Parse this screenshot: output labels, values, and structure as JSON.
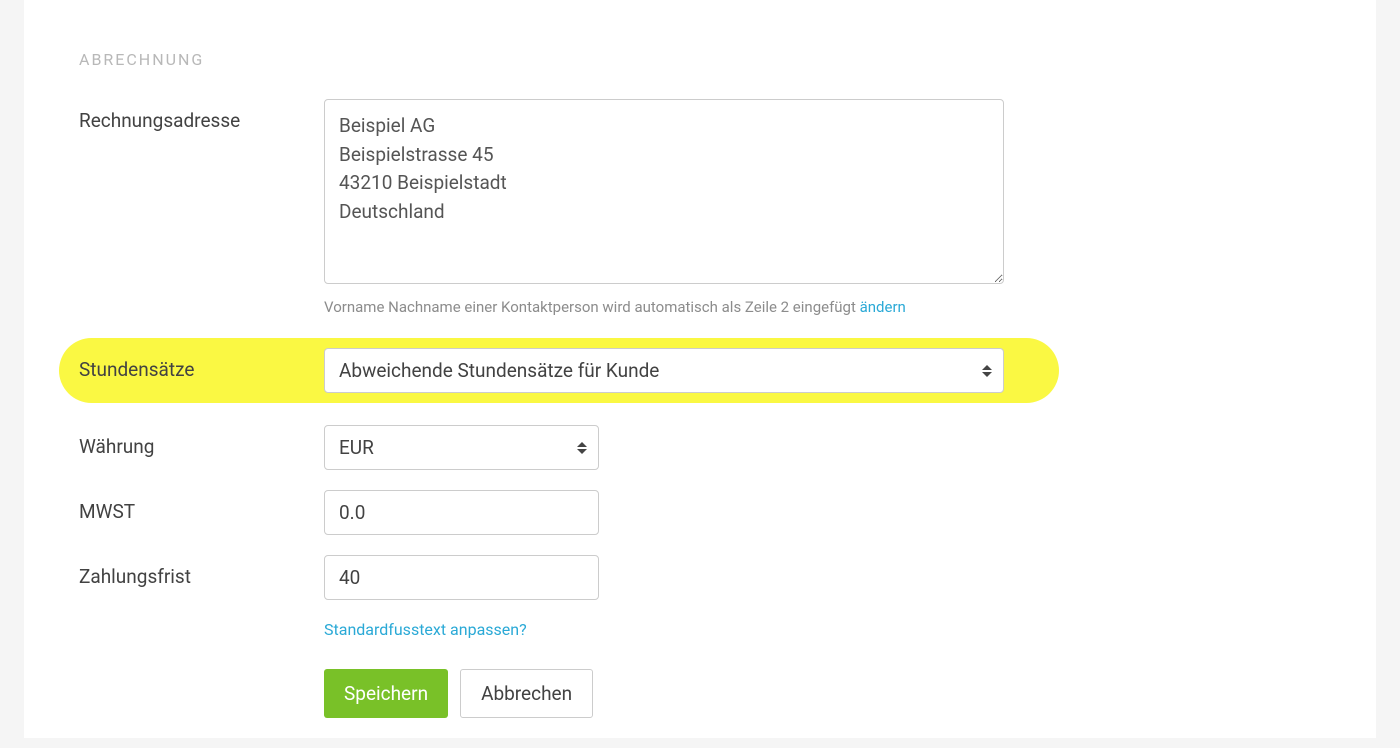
{
  "section": {
    "title": "ABRECHNUNG"
  },
  "fields": {
    "billing_address": {
      "label": "Rechnungsadresse",
      "value": "Beispiel AG\nBeispielstrasse 45\n43210 Beispielstadt\nDeutschland",
      "hint_text": "Vorname Nachname einer Kontaktperson wird automatisch als Zeile 2 eingefügt ",
      "hint_link": "ändern"
    },
    "hourly_rates": {
      "label": "Stundensätze",
      "selected": "Abweichende Stundensätze für Kunde"
    },
    "currency": {
      "label": "Währung",
      "selected": "EUR"
    },
    "vat": {
      "label": "MWST",
      "value": "0.0"
    },
    "payment_due": {
      "label": "Zahlungsfrist",
      "value": "40"
    }
  },
  "footer_link": "Standardfusstext anpassen?",
  "buttons": {
    "save": "Speichern",
    "cancel": "Abbrechen"
  }
}
